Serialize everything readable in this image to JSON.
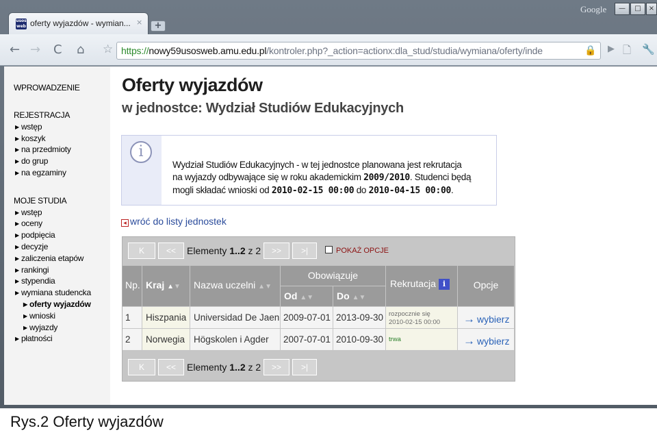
{
  "browser": {
    "tab_title": "oferty wyjazdów - wymian...",
    "tab_close": "×",
    "new_tab": "+",
    "google_label": "Google",
    "win_min": "—",
    "win_max": "□",
    "win_close": "×",
    "favicon_text": "usos web",
    "url_scheme": "https://",
    "url_host": "nowy59usosweb.amu.edu.pl",
    "url_path": "/kontroler.php?_action=actionx:dla_stud/studia/wymiana/oferty/inde",
    "nav": {
      "back": "←",
      "forward": "→",
      "reload": "C",
      "home": "⌂",
      "star": "☆",
      "lock": "🔒",
      "play": "▶",
      "page": "🗋",
      "tools": "🔧"
    }
  },
  "sidebar": {
    "wprowadzenie": "WPROWADZENIE",
    "rejestracja": {
      "heading": "REJESTRACJA",
      "items": [
        "wstęp",
        "koszyk",
        "na przedmioty",
        "do grup",
        "na egzaminy"
      ]
    },
    "moje_studia": {
      "heading": "MOJE STUDIA",
      "items": [
        "wstęp",
        "oceny",
        "podpięcia",
        "decyzje",
        "zaliczenia etapów",
        "rankingi",
        "stypendia",
        "wymiana studencka"
      ],
      "sub_items": [
        "oferty wyjazdów",
        "wnioski",
        "wyjazdy"
      ],
      "last_item": "płatności"
    }
  },
  "main": {
    "title": "Oferty wyjazdów",
    "subtitle": "w jednostce: Wydział Studiów Edukacyjnych",
    "info": {
      "icon": "i",
      "line1": "Wydział Studiów Edukacyjnych - w tej jednostce planowana jest rekrutacja",
      "line2_a": "na wyjazdy odbywające się w roku akademickim ",
      "year": "2009/2010",
      "line2_b": ". Studenci będą",
      "line3_a": "mogli składać wnioski od ",
      "date_from": "2010-02-15 00:00",
      "line3_b": " do ",
      "date_to": "2010-04-15 00:00",
      "line3_c": "."
    },
    "back_link": "wróć do listy jednostek",
    "pager": {
      "first": "K",
      "prev": "<<",
      "next": ">>",
      "last": ">|",
      "label": "Elementy ",
      "range": "1..2",
      "of": " z 2"
    },
    "show_options": "POKAŻ OPCJE",
    "columns": {
      "np": "Np.",
      "kraj": "Kraj",
      "nazwa": "Nazwa uczelni",
      "obowiazuje": "Obowiązuje",
      "od": "Od",
      "do": "Do",
      "rekrutacja": "Rekrutacja",
      "opcje": "Opcje",
      "sort_up": "▲",
      "sort_down": "▼",
      "help": "i"
    },
    "rows": [
      {
        "np": "1",
        "kraj": "Hiszpania",
        "nazwa": "Universidad De Jaen",
        "od": "2009-07-01",
        "do": "2013-09-30",
        "rek_line1": "rozpocznie się",
        "rek_line2": "2010-02-15 00:00",
        "opcje": "wybierz",
        "arrow": "→"
      },
      {
        "np": "2",
        "kraj": "Norwegia",
        "nazwa": "Högskolen i Agder",
        "od": "2007-07-01",
        "do": "2010-09-30",
        "rek_line1": "trwa",
        "rek_line2": "",
        "opcje": "wybierz",
        "arrow": "→"
      }
    ]
  },
  "caption": "Rys.2 Oferty wyjazdów"
}
